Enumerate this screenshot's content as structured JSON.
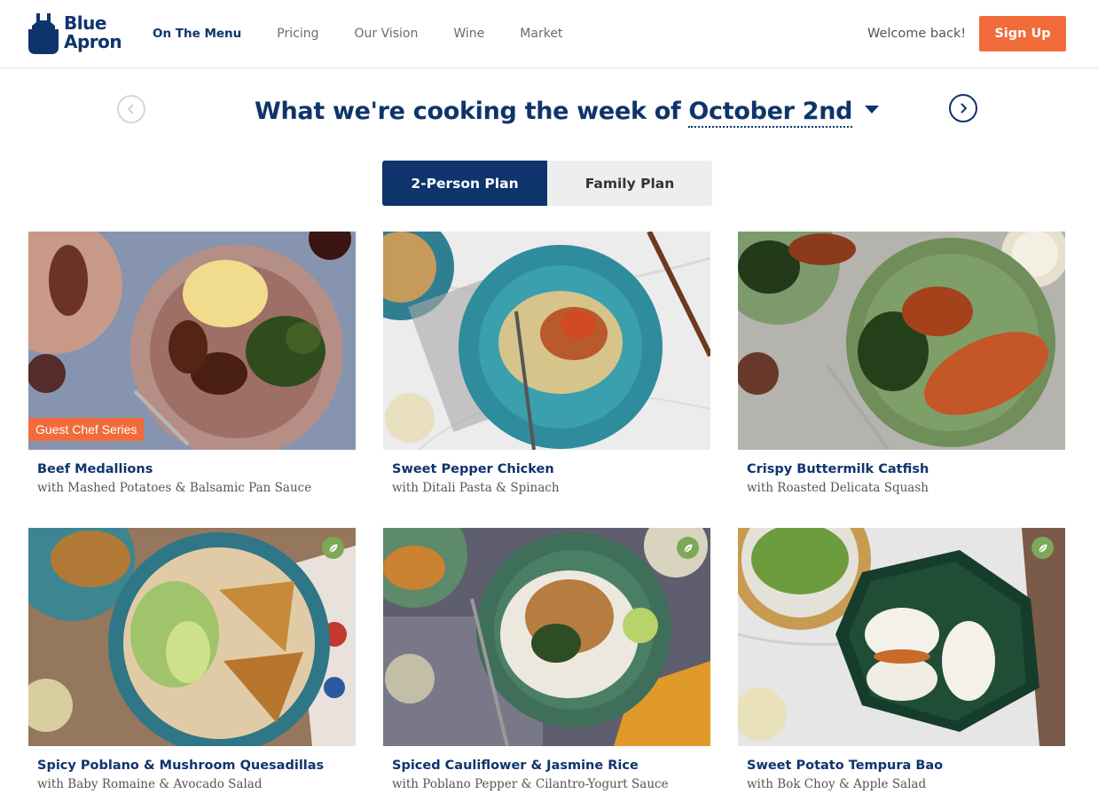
{
  "header": {
    "logo_text": [
      "Blue",
      "Apron"
    ],
    "nav": [
      {
        "label": "On The Menu",
        "active": true
      },
      {
        "label": "Pricing"
      },
      {
        "label": "Our Vision"
      },
      {
        "label": "Wine"
      },
      {
        "label": "Market"
      }
    ],
    "welcome": "Welcome back!",
    "signup_label": "Sign Up"
  },
  "week": {
    "title_prefix": "What we're cooking the week of",
    "date": "October 2nd"
  },
  "plans": {
    "active": "2-Person Plan",
    "inactive": "Family Plan"
  },
  "colors": {
    "brand_navy": "#0f346c",
    "accent_orange": "#f26b3a",
    "veg_green": "#7ca857"
  },
  "recipes": [
    {
      "title": "Beef Medallions",
      "subtitle": "with Mashed Potatoes & Balsamic Pan Sauce",
      "badge": "Guest Chef Series",
      "vegetarian": false
    },
    {
      "title": "Sweet Pepper Chicken",
      "subtitle": "with Ditali Pasta & Spinach",
      "vegetarian": false
    },
    {
      "title": "Crispy Buttermilk Catfish",
      "subtitle": "with Roasted Delicata Squash",
      "vegetarian": false
    },
    {
      "title": "Spicy Poblano & Mushroom Quesadillas",
      "subtitle": "with Baby Romaine & Avocado Salad",
      "vegetarian": true
    },
    {
      "title": "Spiced Cauliflower & Jasmine Rice",
      "subtitle": "with Poblano Pepper & Cilantro-Yogurt Sauce",
      "vegetarian": true
    },
    {
      "title": "Sweet Potato Tempura Bao",
      "subtitle": "with Bok Choy & Apple Salad",
      "vegetarian": true
    }
  ]
}
